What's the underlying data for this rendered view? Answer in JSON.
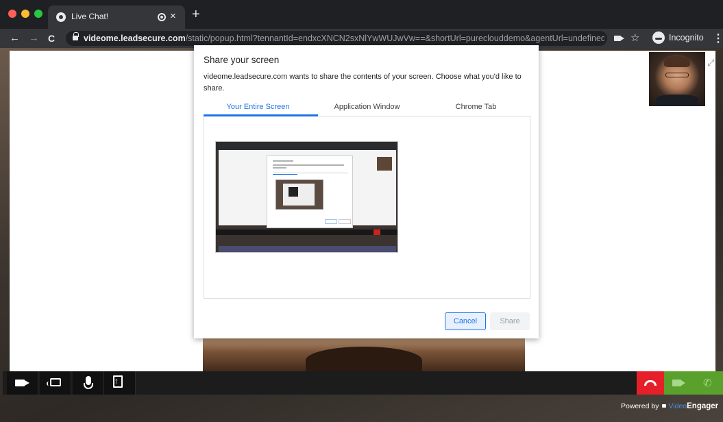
{
  "browser": {
    "tab": {
      "title": "Live Chat!"
    },
    "address_bar": {
      "host": "videome.leadsecure.com",
      "path": "/static/popup.html?tennantId=endxcXNCN2sxNlYwWUJwVw==&shortUrl=pureclouddemo&agentUrl=undefined..."
    },
    "profile_label": "Incognito"
  },
  "share_dialog": {
    "title": "Share your screen",
    "description": "videome.leadsecure.com wants to share the contents of your screen. Choose what you'd like to share.",
    "tabs": [
      {
        "label": "Your Entire Screen",
        "selected": true
      },
      {
        "label": "Application Window",
        "selected": false
      },
      {
        "label": "Chrome Tab",
        "selected": false
      }
    ],
    "cancel_label": "Cancel",
    "share_label": "Share"
  },
  "call_controls": {
    "left": [
      {
        "icon": "camera-icon"
      },
      {
        "icon": "screen-share-icon"
      },
      {
        "icon": "microphone-icon"
      },
      {
        "icon": "file-upload-icon"
      }
    ],
    "right": [
      {
        "icon": "hangup-icon",
        "color": "#e5202a"
      },
      {
        "icon": "video-call-icon",
        "color": "#5aa02c"
      },
      {
        "icon": "phone-icon",
        "color": "#5aa02c"
      }
    ]
  },
  "footer": {
    "powered_by": "Powered by",
    "brand_prefix": "Video",
    "brand_suffix": "Engager"
  },
  "colors": {
    "accent": "#1a73e8",
    "hangup": "#e5202a",
    "call": "#5aa02c"
  }
}
